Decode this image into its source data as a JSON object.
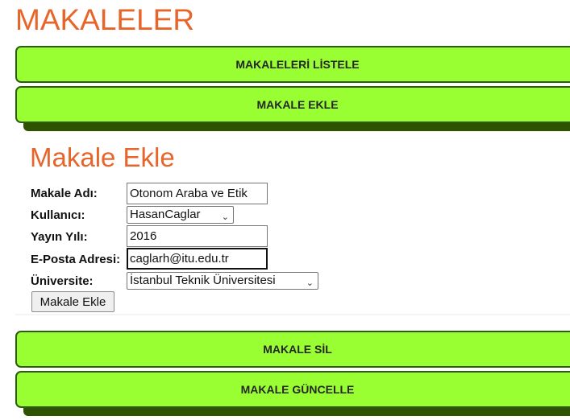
{
  "page": {
    "title": "MAKALELER"
  },
  "nav": {
    "list_articles": "MAKALELERİ LİSTELE",
    "add_article": "MAKALE EKLE",
    "delete_article": "MAKALE SİL",
    "update_article": "MAKALE GÜNCELLE"
  },
  "form": {
    "title": "Makale Ekle",
    "article_name": {
      "label": "Makale Adı:",
      "value": "Otonom Araba ve Etik"
    },
    "user": {
      "label": "Kullanıcı:",
      "value": "HasanCaglar"
    },
    "year": {
      "label": "Yayın Yılı:",
      "value": "2016"
    },
    "email": {
      "label": "E-Posta Adresi:",
      "value": "caglarh@itu.edu.tr"
    },
    "university": {
      "label": "Üniversite:",
      "value": "İstanbul Teknik Üniversitesi"
    },
    "submit_label": "Makale Ekle"
  },
  "colors": {
    "accent": "#e8652a",
    "button_bg": "#99ff33",
    "button_border": "#2f5a16",
    "shadow": "#2e5200"
  }
}
